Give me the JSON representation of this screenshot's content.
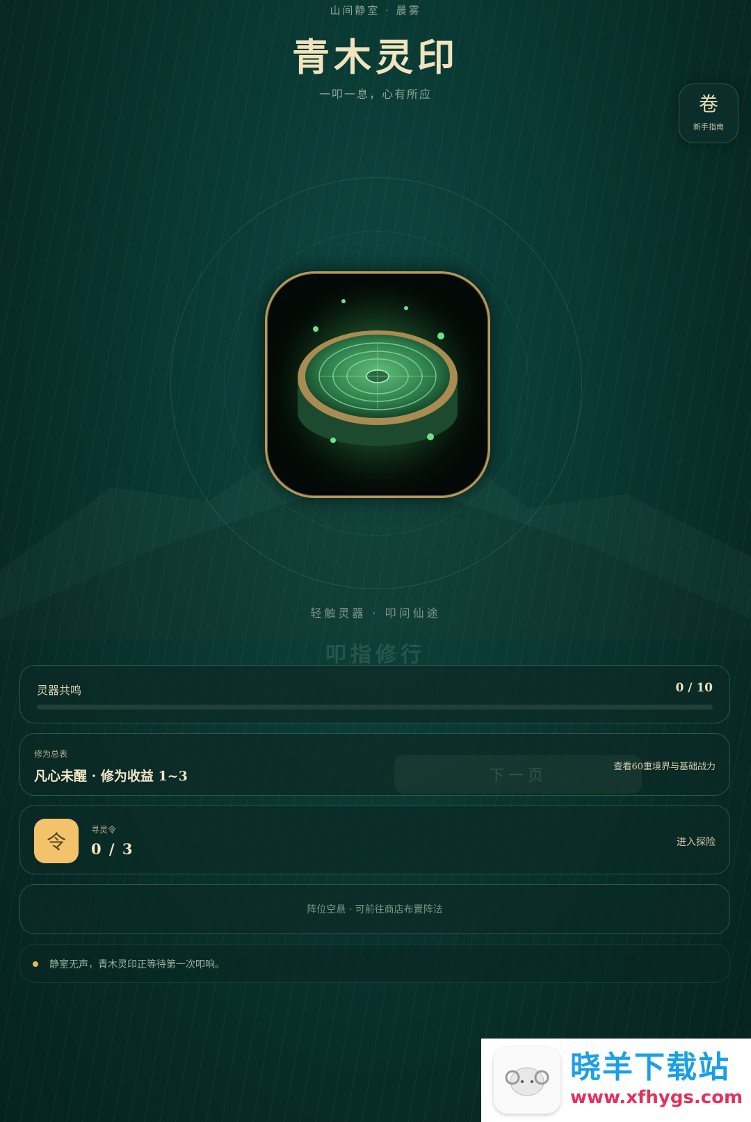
{
  "header": {
    "location": "山间静室 · 晨雾",
    "title": "青木灵印",
    "subtitle": "一叩一息，心有所应"
  },
  "guide_button": {
    "char": "卷",
    "label": "新手指南"
  },
  "artifact": {
    "icon": "jade-seal-artifact"
  },
  "tap_hint": "轻触灵器 · 叩问仙途",
  "ghost_title": "叩指修行",
  "resonance": {
    "label": "灵器共鸣",
    "value": "0 / 10",
    "progress": 0
  },
  "cultivation": {
    "label": "修为总表",
    "value": "凡心未醒 · 修为收益 1~3",
    "ghost_button": "下一页",
    "link": "查看60重境界与基础战力"
  },
  "token": {
    "icon_char": "令",
    "label": "寻灵令",
    "value": "0 / 3",
    "link": "进入探险"
  },
  "formation": {
    "text": "阵位空悬 · 可前往商店布置阵法"
  },
  "log": {
    "text": "静室无声，青木灵印正等待第一次叩响。"
  },
  "watermark": {
    "name": "晓羊下载站",
    "url": "www.xfhygs.com"
  },
  "colors": {
    "accent_gold": "#c9a862",
    "token_yellow": "#f2c36a",
    "bg_green": "#0a3a34"
  }
}
